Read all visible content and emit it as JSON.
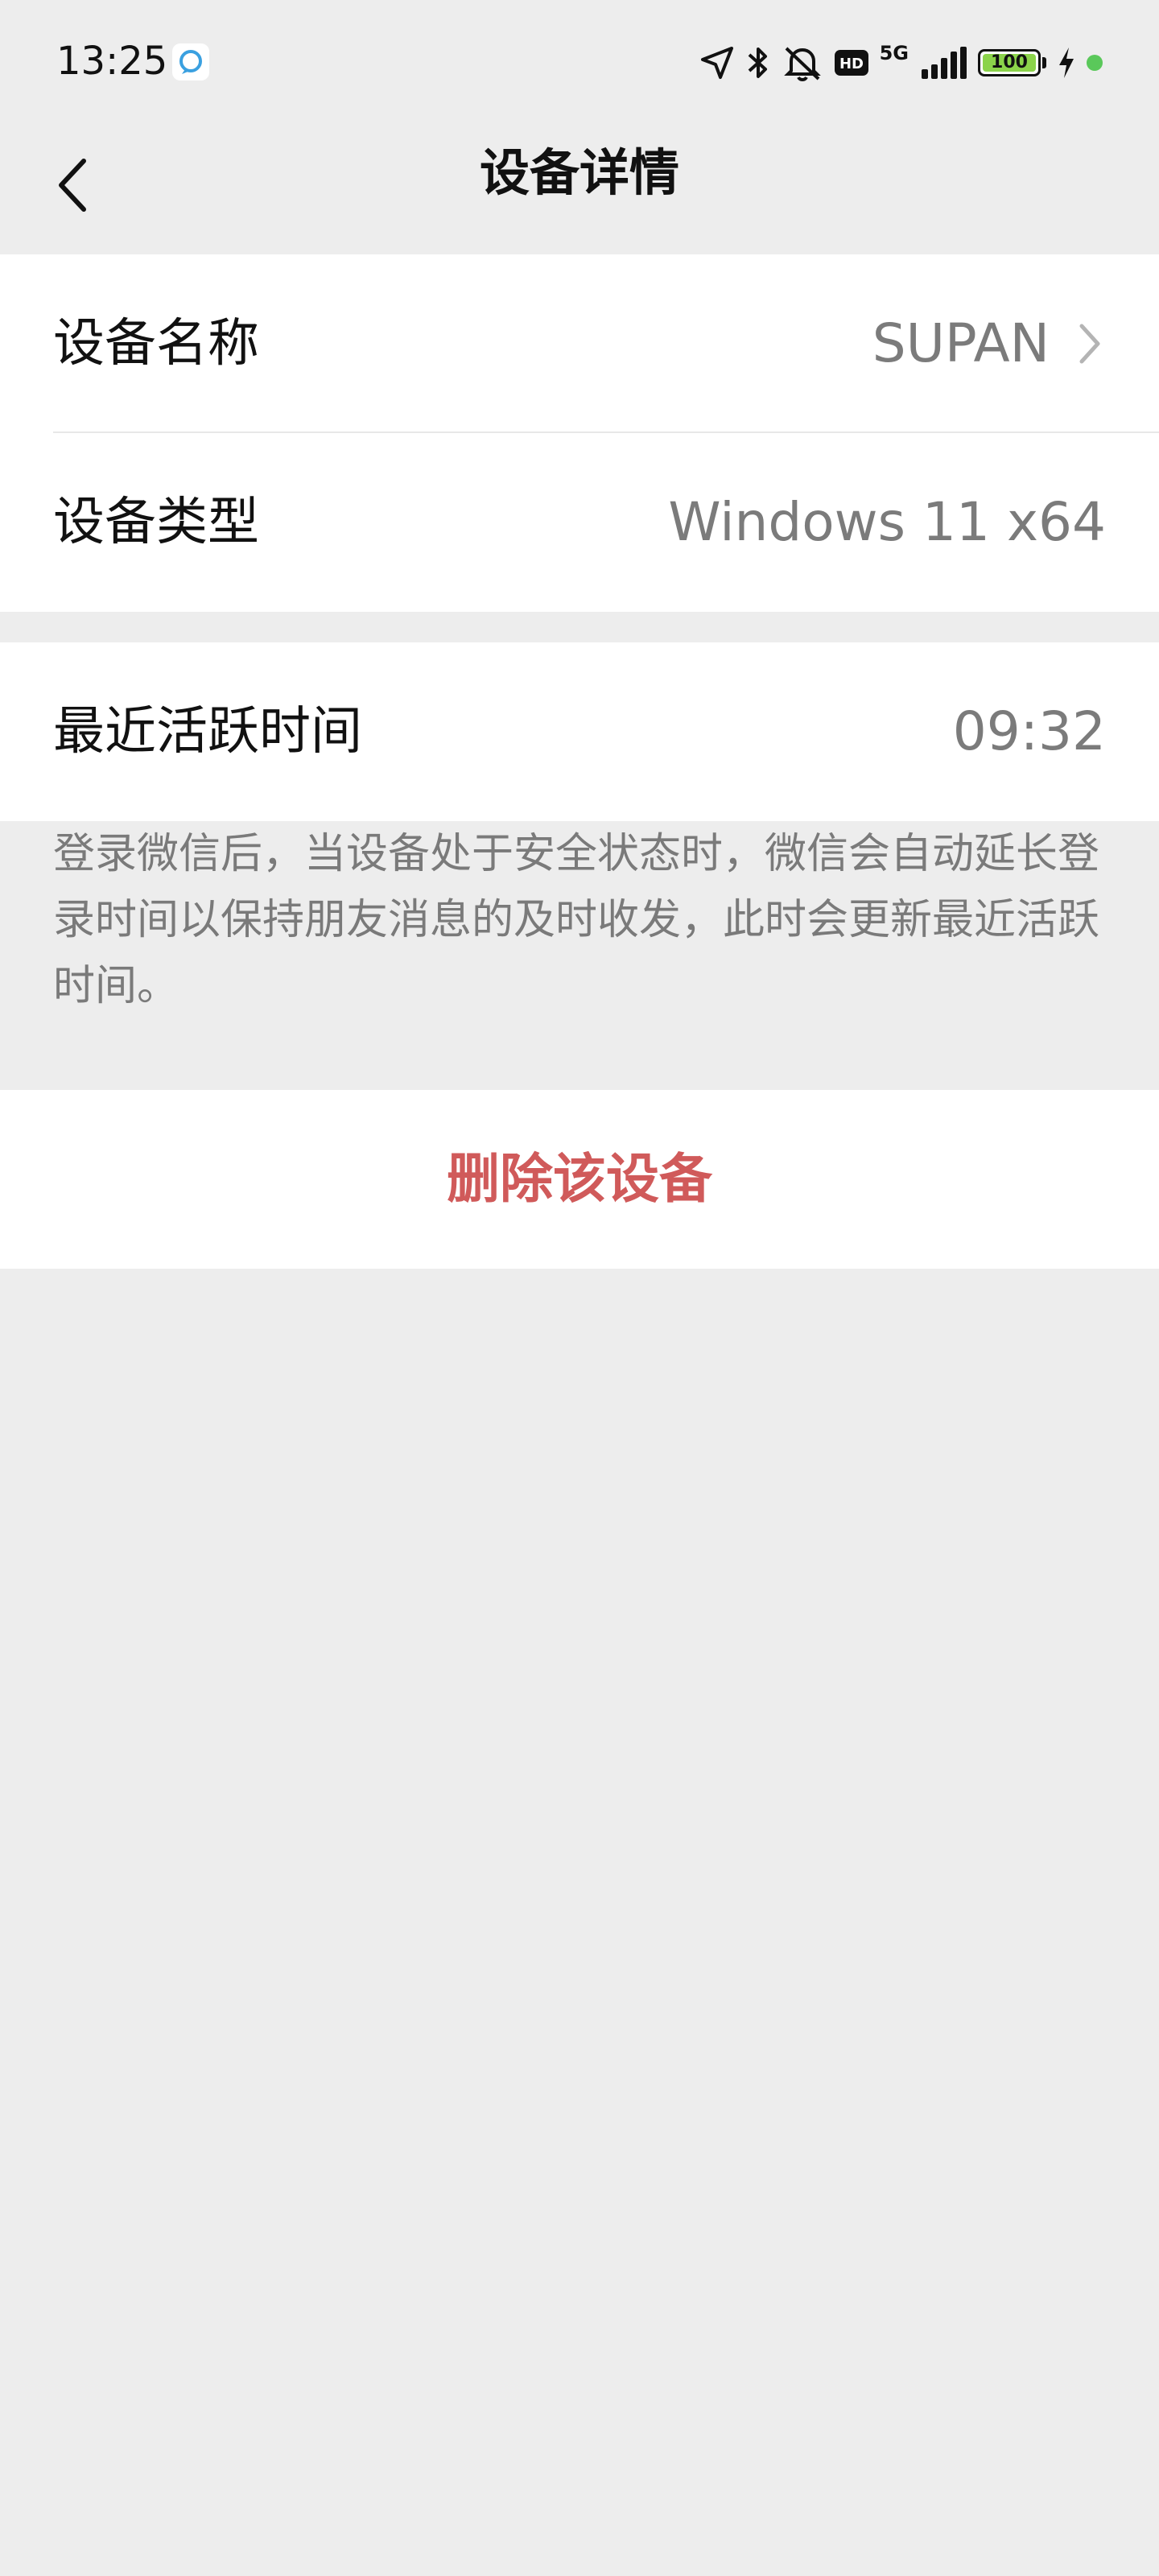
{
  "status_bar": {
    "time": "13:25",
    "network": "5G",
    "hd": "HD",
    "battery_level": "100",
    "colors": {
      "battery_fill": "#8bd34a",
      "indicator_dot": "#5ac85a"
    },
    "icons": [
      "app-notification-icon",
      "location-arrow-icon",
      "bluetooth-icon",
      "silent-bell-icon",
      "hd-icon",
      "signal-icon",
      "battery-icon",
      "charging-bolt-icon",
      "indicator-dot"
    ]
  },
  "nav": {
    "title": "设备详情",
    "back_icon": "chevron-left-icon"
  },
  "device": {
    "name_label": "设备名称",
    "name_value": "SUPAN",
    "type_label": "设备类型",
    "type_value": "Windows 11 x64"
  },
  "activity": {
    "last_active_label": "最近活跃时间",
    "last_active_value": "09:32",
    "note": "登录微信后，当设备处于安全状态时，微信会自动延长登录时间以保持朋友消息的及时收发，此时会更新最近活跃时间。"
  },
  "actions": {
    "delete_label": "删除该设备",
    "delete_color": "#d05a5a"
  }
}
